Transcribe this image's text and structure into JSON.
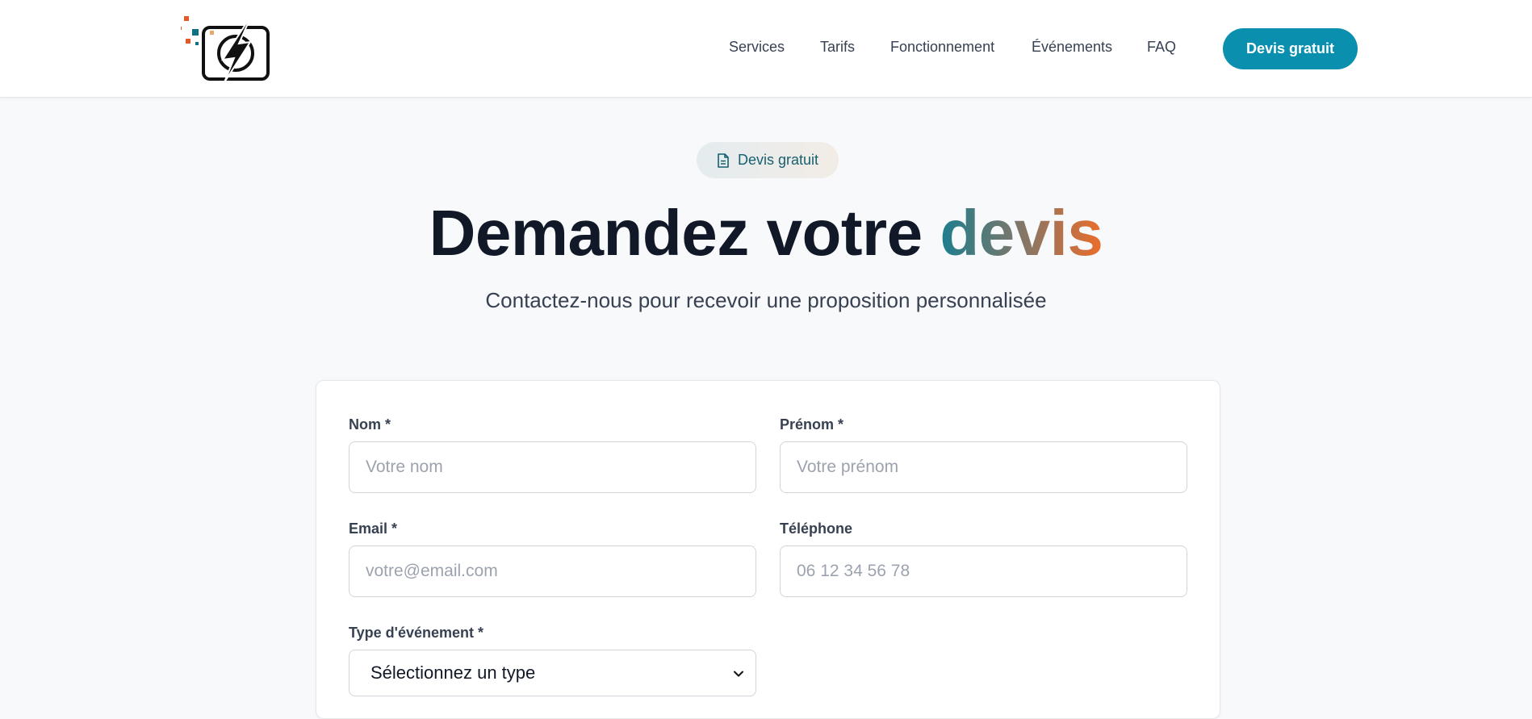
{
  "header": {
    "logo_icon": "lightning-camera-logo",
    "nav": [
      {
        "label": "Services"
      },
      {
        "label": "Tarifs"
      },
      {
        "label": "Fonctionnement"
      },
      {
        "label": "Événements"
      },
      {
        "label": "FAQ"
      }
    ],
    "cta_label": "Devis gratuit"
  },
  "hero": {
    "badge_icon": "document-icon",
    "badge_label": "Devis gratuit",
    "title_main": "Demandez votre ",
    "title_accent": "devis",
    "subtitle": "Contactez-nous pour recevoir une proposition personnalisée"
  },
  "form": {
    "nom_label": "Nom *",
    "nom_placeholder": "Votre nom",
    "prenom_label": "Prénom *",
    "prenom_placeholder": "Votre prénom",
    "email_label": "Email *",
    "email_placeholder": "votre@email.com",
    "telephone_label": "Téléphone",
    "telephone_placeholder": "06 12 34 56 78",
    "type_label": "Type d'événement *",
    "type_selected": "Sélectionnez un type"
  },
  "colors": {
    "accent": "#0a8fae",
    "badge_text": "#17606f",
    "gradient_start": "#1b7d8f",
    "gradient_end": "#ec6d2a"
  }
}
